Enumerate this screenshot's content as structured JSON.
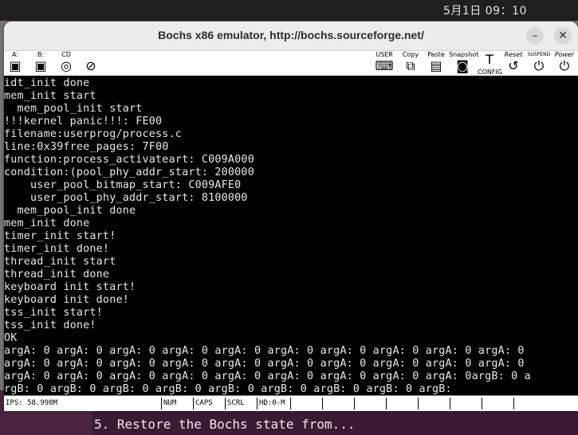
{
  "clock": "5月1日  09：10",
  "window": {
    "title": "Bochs x86 emulator, http://bochs.sourceforge.net/",
    "minimize": "–",
    "close": "✕"
  },
  "toolbar": {
    "drives": [
      {
        "label": "A:",
        "icon": "floppy-a-icon"
      },
      {
        "label": "B:",
        "icon": "floppy-b-icon"
      },
      {
        "label": "CD",
        "icon": "cdrom-icon"
      },
      {
        "label": "",
        "icon": "mouse-icon"
      }
    ],
    "user_label": "USER",
    "copy_label": "Copy",
    "paste_label": "Paste",
    "snapshot_label": "Snapshot",
    "config_label": "CONFIG",
    "reset_label": "Reset",
    "suspend_label": "SUSPEND",
    "power_label": "Power"
  },
  "console": {
    "lines": [
      "idt_init done",
      "mem_init start",
      "  mem_pool_init start",
      "!!!kernel panic!!!: FE00",
      "filename:userprog/process.c",
      "line:0x39free_pages: 7F00",
      "function:process_activateart: C009A000",
      "condition:(pool_phy_addr_start: 200000",
      "    user_pool_bitmap_start: C009AFE0",
      "    user_pool_phy_addr_start: 8100000",
      "  mem_pool_init done",
      "mem_init done",
      "timer_init start!",
      "timer_init done!",
      "thread_init start",
      "thread_init done",
      "keyboard init start!",
      "keyboard init done!",
      "tss_init start!",
      "tss_init done!",
      "OK",
      "argA: 0 argA: 0 argA: 0 argA: 0 argA: 0 argA: 0 argA: 0 argA: 0 argA: 0 argA: 0",
      "argA: 0 argA: 0 argA: 0 argA: 0 argA: 0 argA: 0 argA: 0 argA: 0 argA: 0 argA: 0",
      "argA: 0 argA: 0 argA: 0 argA: 0 argA: 0 argA: 0 argA: 0 argA: 0 argA: 0argB: 0 a",
      "rgB: 0 argB: 0 argB: 0 argB: 0 argB: 0 argB: 0 argB: 0 argB: 0 argB:"
    ]
  },
  "statusbar": {
    "ips": "IPS: 58.998M",
    "num": "NUM",
    "caps": "CAPS",
    "scrl": "SCRL",
    "hd": "HD:0-M"
  },
  "background_terminal": {
    "line": "5. Restore the Bochs state from..."
  },
  "colors": {
    "console_bg": "#000000",
    "console_fg": "#e8e8e8",
    "terminal_bg": "#3d1a33"
  }
}
